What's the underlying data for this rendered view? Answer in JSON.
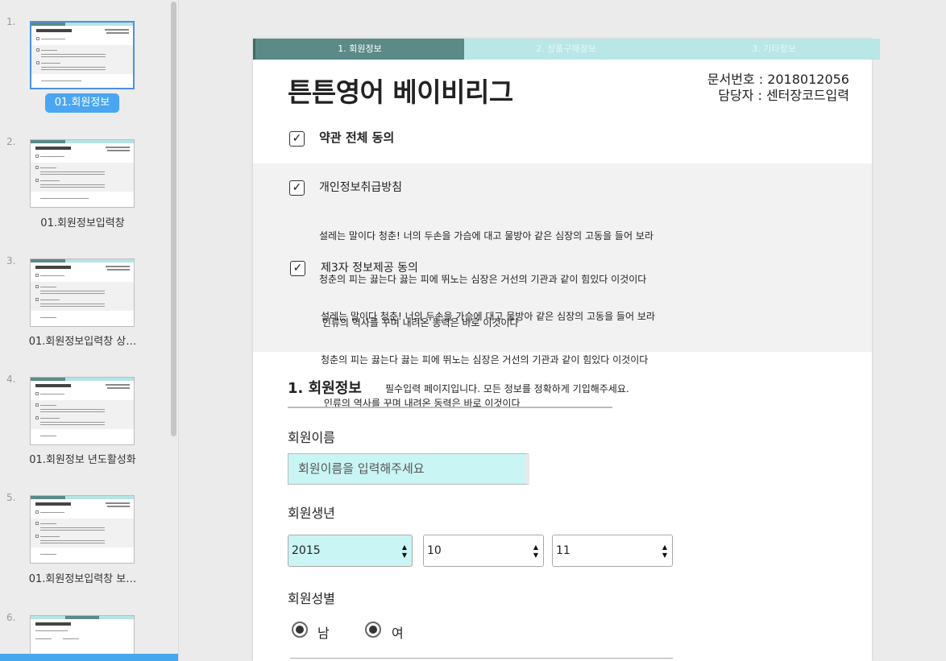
{
  "sidebar": {
    "slides": [
      {
        "num": "1.",
        "label": "01.회원정보"
      },
      {
        "num": "2.",
        "label": "01.회원정보입력창"
      },
      {
        "num": "3.",
        "label": "01.회원정보입력창 상…"
      },
      {
        "num": "4.",
        "label": "01.회원정보 년도활성화"
      },
      {
        "num": "5.",
        "label": "01.회원정보입력창 보…"
      },
      {
        "num": "6.",
        "label": ""
      }
    ],
    "selected_index": 0
  },
  "tabs": [
    "1. 회원정보",
    "2. 상품구매정보",
    "3. 기타정보"
  ],
  "header": {
    "title": "튼튼영어 베이비리그",
    "doc_number": "문서번호 : 2018012056",
    "manager": "담당자 : 센터장코드입력"
  },
  "agreements": {
    "all_label": "약관 전체 동의",
    "items": [
      {
        "title": "개인정보취급방침",
        "lines": [
          "설레는 말이다 청춘! 너의 두손을 가슴에 대고 물방아 같은 심장의 고동을 들어 보라",
          "청춘의 피는 끓는다 끓는 피에 뛰노는 심장은 거선의 기관과 같이 힘있다 이것이다",
          " 인류의 역사를 꾸며 내려온 동력은 바로 이것이다"
        ]
      },
      {
        "title": "제3자 정보제공 동의",
        "lines": [
          "설레는 말이다 청춘! 너의 두손을 가슴에 대고 물방아 같은 심장의 고동을 들어 보라",
          "청춘의 피는 끓는다 끓는 피에 뛰노는 심장은 거선의 기관과 같이 힘있다 이것이다",
          " 인류의 역사를 꾸며 내려온 동력은 바로 이것이다"
        ]
      }
    ],
    "check_mark": "✓"
  },
  "section": {
    "title": "1. 회원정보",
    "description": "필수입력 페이지입니다. 모든 정보를 정확하게 기입해주세요."
  },
  "form": {
    "name_label": "회원이름",
    "name_placeholder": "회원이름을 입력해주세요",
    "birth_label": "회원생년",
    "birth_year": "2015",
    "birth_month": "10",
    "birth_day": "11",
    "gender_label": "회원성별",
    "gender_options": [
      "남",
      "여"
    ]
  },
  "colors": {
    "active_tab": "#5b8a87",
    "inactive_tab": "#b9e6e6",
    "input_highlight": "#c9f5f4",
    "selection_blue": "#4aa6f2"
  }
}
